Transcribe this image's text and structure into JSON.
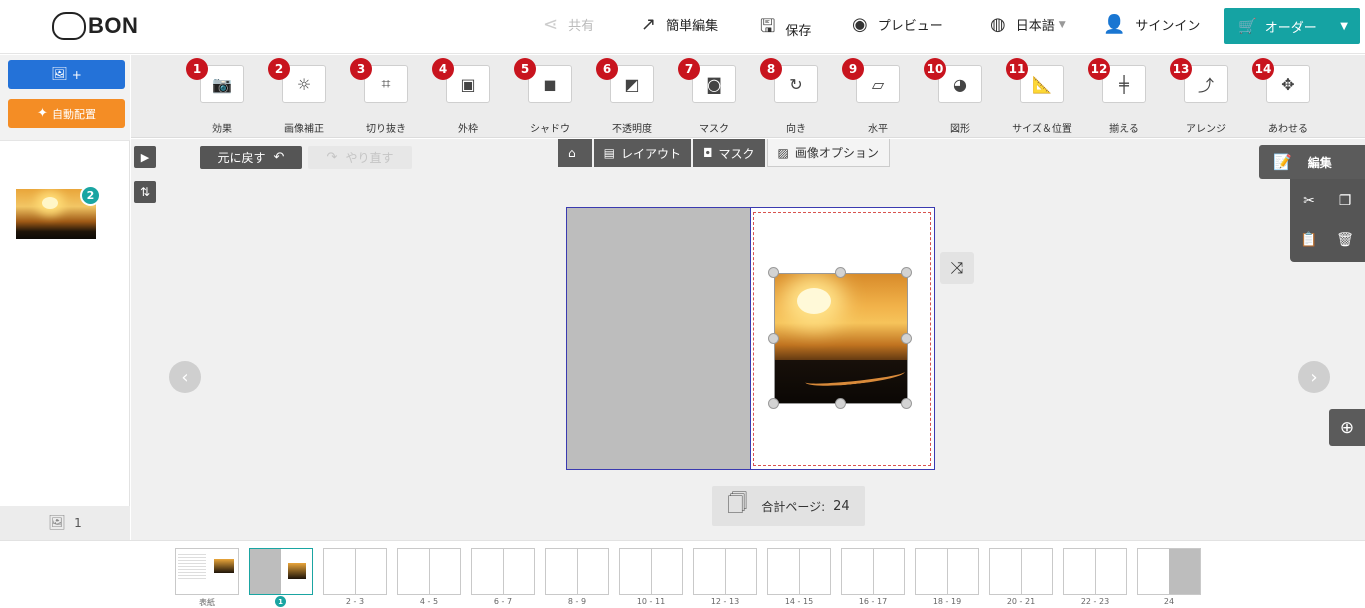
{
  "header": {
    "logo": "BON",
    "share": "共有",
    "simple_edit": "簡単編集",
    "save": "保存",
    "preview": "プレビュー",
    "language": "日本語",
    "signin": "サインイン",
    "order": "オーダー"
  },
  "sidebar": {
    "add_label": "+",
    "auto_label": "自動配置",
    "thumb_badge": "2",
    "photo_count": "1"
  },
  "toolbar": {
    "tools": [
      {
        "num": "1",
        "label": "効果",
        "icon": "camera-star-icon",
        "glyph": "📷"
      },
      {
        "num": "2",
        "label": "画像補正",
        "icon": "brightness-icon",
        "glyph": "☼"
      },
      {
        "num": "3",
        "label": "切り抜き",
        "icon": "crop-icon",
        "glyph": "⌗"
      },
      {
        "num": "4",
        "label": "外枠",
        "icon": "frame-icon",
        "glyph": "▣"
      },
      {
        "num": "5",
        "label": "シャドウ",
        "icon": "shadow-icon",
        "glyph": "◼"
      },
      {
        "num": "6",
        "label": "不透明度",
        "icon": "opacity-icon",
        "glyph": "◩"
      },
      {
        "num": "7",
        "label": "マスク",
        "icon": "mask-icon",
        "glyph": "◙"
      },
      {
        "num": "8",
        "label": "向き",
        "icon": "rotate-icon",
        "glyph": "↻"
      },
      {
        "num": "9",
        "label": "水平",
        "icon": "level-icon",
        "glyph": "▱"
      },
      {
        "num": "10",
        "label": "図形",
        "icon": "shape-icon",
        "glyph": "◕"
      },
      {
        "num": "11",
        "label": "サイズ＆位置",
        "icon": "ruler-icon",
        "glyph": "📐"
      },
      {
        "num": "12",
        "label": "揃える",
        "icon": "align-icon",
        "glyph": "╪"
      },
      {
        "num": "13",
        "label": "アレンジ",
        "icon": "arrange-icon",
        "glyph": "⤴"
      },
      {
        "num": "14",
        "label": "あわせる",
        "icon": "move-icon",
        "glyph": "✥"
      }
    ]
  },
  "main": {
    "undo": "元に戻す",
    "redo": "やり直す",
    "tabs": [
      {
        "label": "",
        "icon": "home-icon",
        "glyph": "⌂"
      },
      {
        "label": "レイアウト",
        "icon": "layout-icon",
        "glyph": "▤"
      },
      {
        "label": "マスク",
        "icon": "mask-tab-icon",
        "glyph": "◘"
      },
      {
        "label": "画像オプション",
        "icon": "image-options-icon",
        "glyph": "▨"
      }
    ],
    "page_count_label": "合計ページ:",
    "page_count_value": "24",
    "edit_label": "編集"
  },
  "strip": {
    "pages": [
      {
        "label": "表紙"
      },
      {
        "label": "1",
        "badge": true
      },
      {
        "label": "2 - 3"
      },
      {
        "label": "4 - 5"
      },
      {
        "label": "6 - 7"
      },
      {
        "label": "8 - 9"
      },
      {
        "label": "10 - 11"
      },
      {
        "label": "12 - 13"
      },
      {
        "label": "14 - 15"
      },
      {
        "label": "16 - 17"
      },
      {
        "label": "18 - 19"
      },
      {
        "label": "20 - 21"
      },
      {
        "label": "22 - 23"
      },
      {
        "label": "24"
      }
    ]
  },
  "colors": {
    "accent": "#15a3a3",
    "tool_number": "#c8141e",
    "add_button": "#2472d8",
    "auto_button": "#f48d25"
  }
}
